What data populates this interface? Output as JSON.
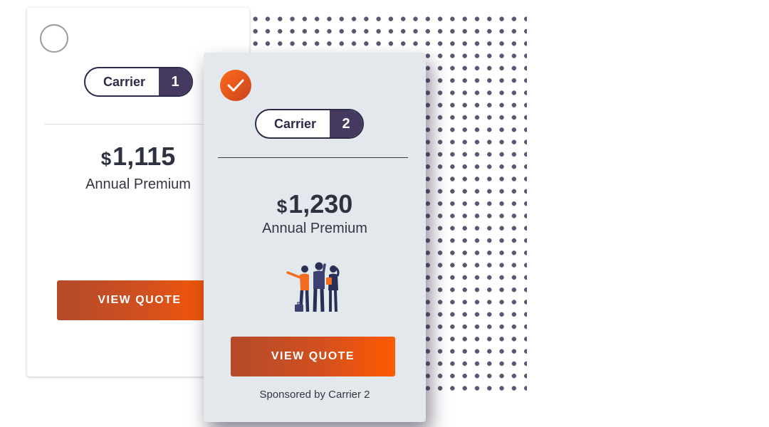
{
  "card_1": {
    "selected": false,
    "carrier_label": "Carrier",
    "carrier_number": "1",
    "currency": "$",
    "amount": "1,115",
    "premium_label": "Annual Premium",
    "button_label": "VIEW QUOTE"
  },
  "card_2": {
    "selected": true,
    "carrier_label": "Carrier",
    "carrier_number": "2",
    "currency": "$",
    "amount": "1,230",
    "premium_label": "Annual Premium",
    "button_label": "VIEW QUOTE",
    "sponsor_text": "Sponsored by Carrier 2"
  },
  "colors": {
    "accent_orange": "#ff5a00",
    "accent_dark": "#45395f",
    "card_selected_bg": "#e3e8ed",
    "dot_pattern": "#5b5670"
  },
  "icons": [
    "radio-unselected-icon",
    "checkmark-icon",
    "people-illustration"
  ]
}
